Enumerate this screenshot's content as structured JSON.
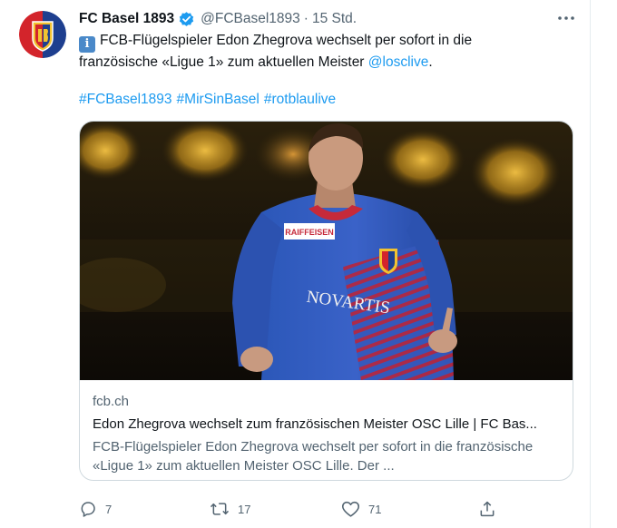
{
  "tweet": {
    "author_name": "FC Basel 1893",
    "handle": "@FCBasel1893",
    "separator": "·",
    "time": "15 Std.",
    "badge": "i",
    "text_main": "FCB-Flügelspieler Edon Zhegrova wechselt per sofort in die französische «Ligue 1» zum aktuellen Meister ",
    "mention": "@losclive",
    "text_end": ".",
    "hashtags": [
      "#FCBasel1893",
      "#MirSinBasel",
      "#rotblaulive"
    ]
  },
  "card": {
    "domain": "fcb.ch",
    "title": "Edon Zhegrova wechselt zum französischen Meister OSC Lille | FC Bas...",
    "description": "FCB-Flügelspieler Edon Zhegrova wechselt per sofort in die französische «Ligue 1» zum aktuellen Meister OSC Lille. Der ...",
    "jersey_sponsor": "RAIFFEISEN",
    "jersey_brand": "NOVARTIS"
  },
  "actions": {
    "reply_count": "7",
    "retweet_count": "17",
    "like_count": "71"
  },
  "icons": {
    "verified": "verified-badge-icon",
    "more": "more-options-icon",
    "reply": "reply-icon",
    "retweet": "retweet-icon",
    "like": "like-icon",
    "share": "share-icon"
  },
  "colors": {
    "link": "#1d9bf0",
    "muted": "#536471",
    "verified": "#1d9bf0",
    "club_red": "#d3242b",
    "club_blue": "#1e3f8f"
  }
}
